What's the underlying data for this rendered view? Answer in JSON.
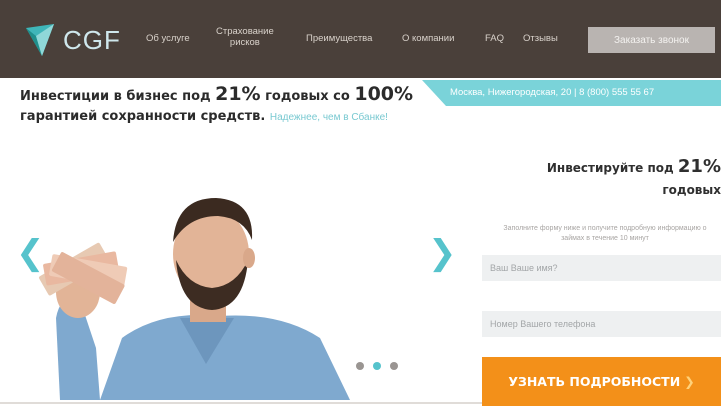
{
  "header": {
    "logo_text": "CGF",
    "nav": [
      {
        "label": "Об услуге"
      },
      {
        "label": "Страхование\nрисков"
      },
      {
        "label": "Преимущества"
      },
      {
        "label": "О компании"
      },
      {
        "label": "FAQ"
      },
      {
        "label": "Отзывы"
      }
    ],
    "call_button": "Заказать звонок"
  },
  "ribbon": {
    "address": "Москва, Нижегородская, 20  |  8 (800) 555 55 67"
  },
  "headline": {
    "part1": "Инвестиции в бизнес под ",
    "percent": "21%",
    "part2": " годовых со ",
    "guarantee": "100%",
    "part3": "гарантией сохранности средств.",
    "link": "Надежнее, чем в Сбанке!"
  },
  "slider": {
    "prev_glyph": "❮",
    "next_glyph": "❯",
    "dots": [
      false,
      true,
      false
    ]
  },
  "form": {
    "title_part1": "Инвестируйте под ",
    "title_percent": "21%",
    "title_part2": "годовых",
    "note": "Заполните форму ниже и получите подробную информацию о займах в течение 10 минут",
    "name_placeholder": "Ваш Ваше имя?",
    "phone_placeholder": "Номер Вашего телефона",
    "submit": "УЗНАТЬ ПОДРОБНОСТИ",
    "submit_arrow": "❯"
  },
  "colors": {
    "header_bg": "#4a403a",
    "accent": "#56c3cc",
    "button_orange": "#f39019"
  }
}
